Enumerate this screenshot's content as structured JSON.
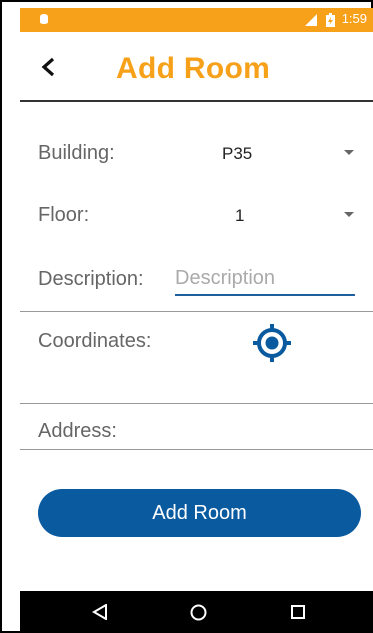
{
  "status_bar": {
    "time": "1:59",
    "icons": [
      "notification-icon",
      "sim-icon",
      "battery-charging-icon"
    ]
  },
  "header": {
    "back_icon": "back-arrow-icon",
    "title": "Add Room"
  },
  "form": {
    "building": {
      "label": "Building:",
      "value": "P35"
    },
    "floor": {
      "label": "Floor:",
      "value": "1"
    },
    "description": {
      "label": "Description:",
      "placeholder": "Description",
      "value": ""
    },
    "coordinates": {
      "label": "Coordinates:",
      "icon": "location-target-icon"
    },
    "address": {
      "label": "Address:"
    }
  },
  "actions": {
    "add_room_label": "Add Room"
  },
  "nav_bar": {
    "icons": [
      "back-triangle-icon",
      "home-circle-icon",
      "recents-square-icon"
    ]
  },
  "colors": {
    "accent": "#f7a11a",
    "primary": "#0a5aa0"
  }
}
